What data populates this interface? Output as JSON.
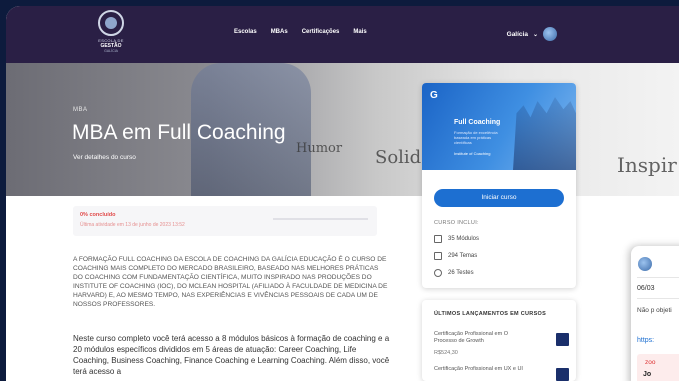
{
  "nav": {
    "logo": {
      "line1": "ESCOLA DE",
      "line2": "GESTÃO",
      "line3": "GALÍCIA"
    },
    "menu": [
      "Escolas",
      "MBAs",
      "Certificações",
      "Mais"
    ],
    "region": "Galícia"
  },
  "hero": {
    "label": "MBA",
    "title": "MBA em Full Coaching",
    "details_link": "Ver detalhes do curso",
    "sketch_words": [
      "Humor",
      "Solid",
      "Inspir"
    ]
  },
  "progress": {
    "percent_label": "0% concluído",
    "percent_value": 0,
    "last_activity": "Última atividade em 13 de junho de 2023 13:52"
  },
  "description": "A FORMAÇÃO FULL COACHING DA ESCOLA DE COACHING DA GALÍCIA EDUCAÇÃO É O CURSO DE COACHING MAIS COMPLETO DO MERCADO BRASILEIRO, BASEADO NAS MELHORES PRÁTICAS DO COACHING COM FUNDAMENTAÇÃO CIENTÍFICA, MUITO INSPIRADO NAS PRODUÇÕES DO INSTITUTE OF COACHING (IOC), DO MCLEAN HOSPITAL (AFILIADO À FACULDADE DE MEDICINA DE HARVARD) E, AO MESMO TEMPO, NAS EXPERIÊNCIAS E VIVÊNCIAS PESSOAIS DE CADA UM DE NOSSOS PROFESSORES.",
  "lead": "Neste curso completo você terá acesso a 8 módulos básicos à formação de coaching e a 20 módulos específicos divididos em 5 áreas de atuação: Career Coaching, Life Coaching, Business Coaching, Finance Coaching e Learning Coaching. Além disso, você terá acesso a",
  "course_card": {
    "cover_logo": "G",
    "cover_title": "Full Coaching",
    "cover_subtitle": "Formação de excelência baseada em práticas científicas",
    "cover_brand": "Institute of Coaching",
    "start_button": "Iniciar curso",
    "includes_label": "CURSO INCLUI:",
    "items": [
      {
        "icon": "modules-icon",
        "text": "35 Módulos"
      },
      {
        "icon": "topics-icon",
        "text": "294 Temas"
      },
      {
        "icon": "tests-icon",
        "text": "26 Testes"
      }
    ]
  },
  "launches": {
    "heading": "ÚLTIMOS LANÇAMENTOS EM CURSOS",
    "items": [
      {
        "name": "Certificação Profissional em O Processo de Growth",
        "price": "R$524,30"
      },
      {
        "name": "Certificação Profissional em UX e UI",
        "price": ""
      }
    ]
  },
  "popup": {
    "date": "06/03",
    "text": "Não p objeti",
    "link": "https:",
    "box_line1": "zoo",
    "box_line2": "Jo"
  }
}
